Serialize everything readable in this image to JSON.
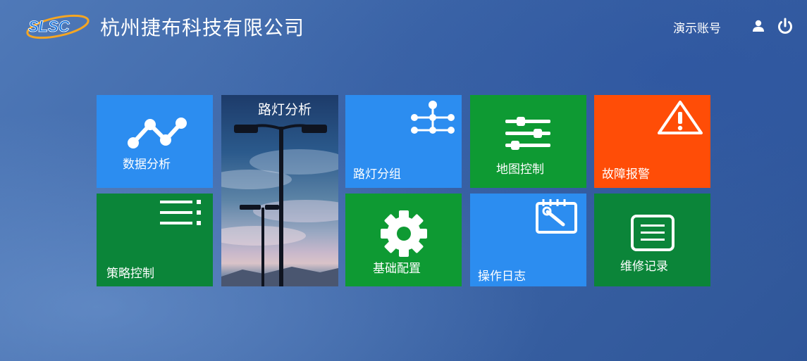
{
  "header": {
    "logo_text": "SLSC",
    "company_name": "杭州捷布科技有限公司",
    "account_label": "演示账号",
    "user_icon": "user-icon",
    "power_icon": "power-icon"
  },
  "tiles": {
    "data_analysis": {
      "label": "数据分析",
      "icon": "line-chart-icon",
      "color": "#2c8df0"
    },
    "streetlight_analysis": {
      "label": "路灯分析",
      "icon": "streetlight-photo"
    },
    "strategy_control": {
      "label": "策略控制",
      "icon": "list-icon",
      "color": "#0b8539"
    },
    "streetlight_group": {
      "label": "路灯分组",
      "icon": "network-icon",
      "color": "#2c8df0"
    },
    "basic_config": {
      "label": "基础配置",
      "icon": "gear-icon",
      "color": "#0e9a33"
    },
    "map_control": {
      "label": "地图控制",
      "icon": "sliders-icon",
      "color": "#0e9a33"
    },
    "operation_log": {
      "label": "操作日志",
      "icon": "notepad-tool-icon",
      "color": "#2c8df0"
    },
    "fault_alarm": {
      "label": "故障报警",
      "icon": "warning-icon",
      "color": "#ff4d07"
    },
    "maintenance_record": {
      "label": "维修记录",
      "icon": "document-icon",
      "color": "#0b8539"
    }
  }
}
